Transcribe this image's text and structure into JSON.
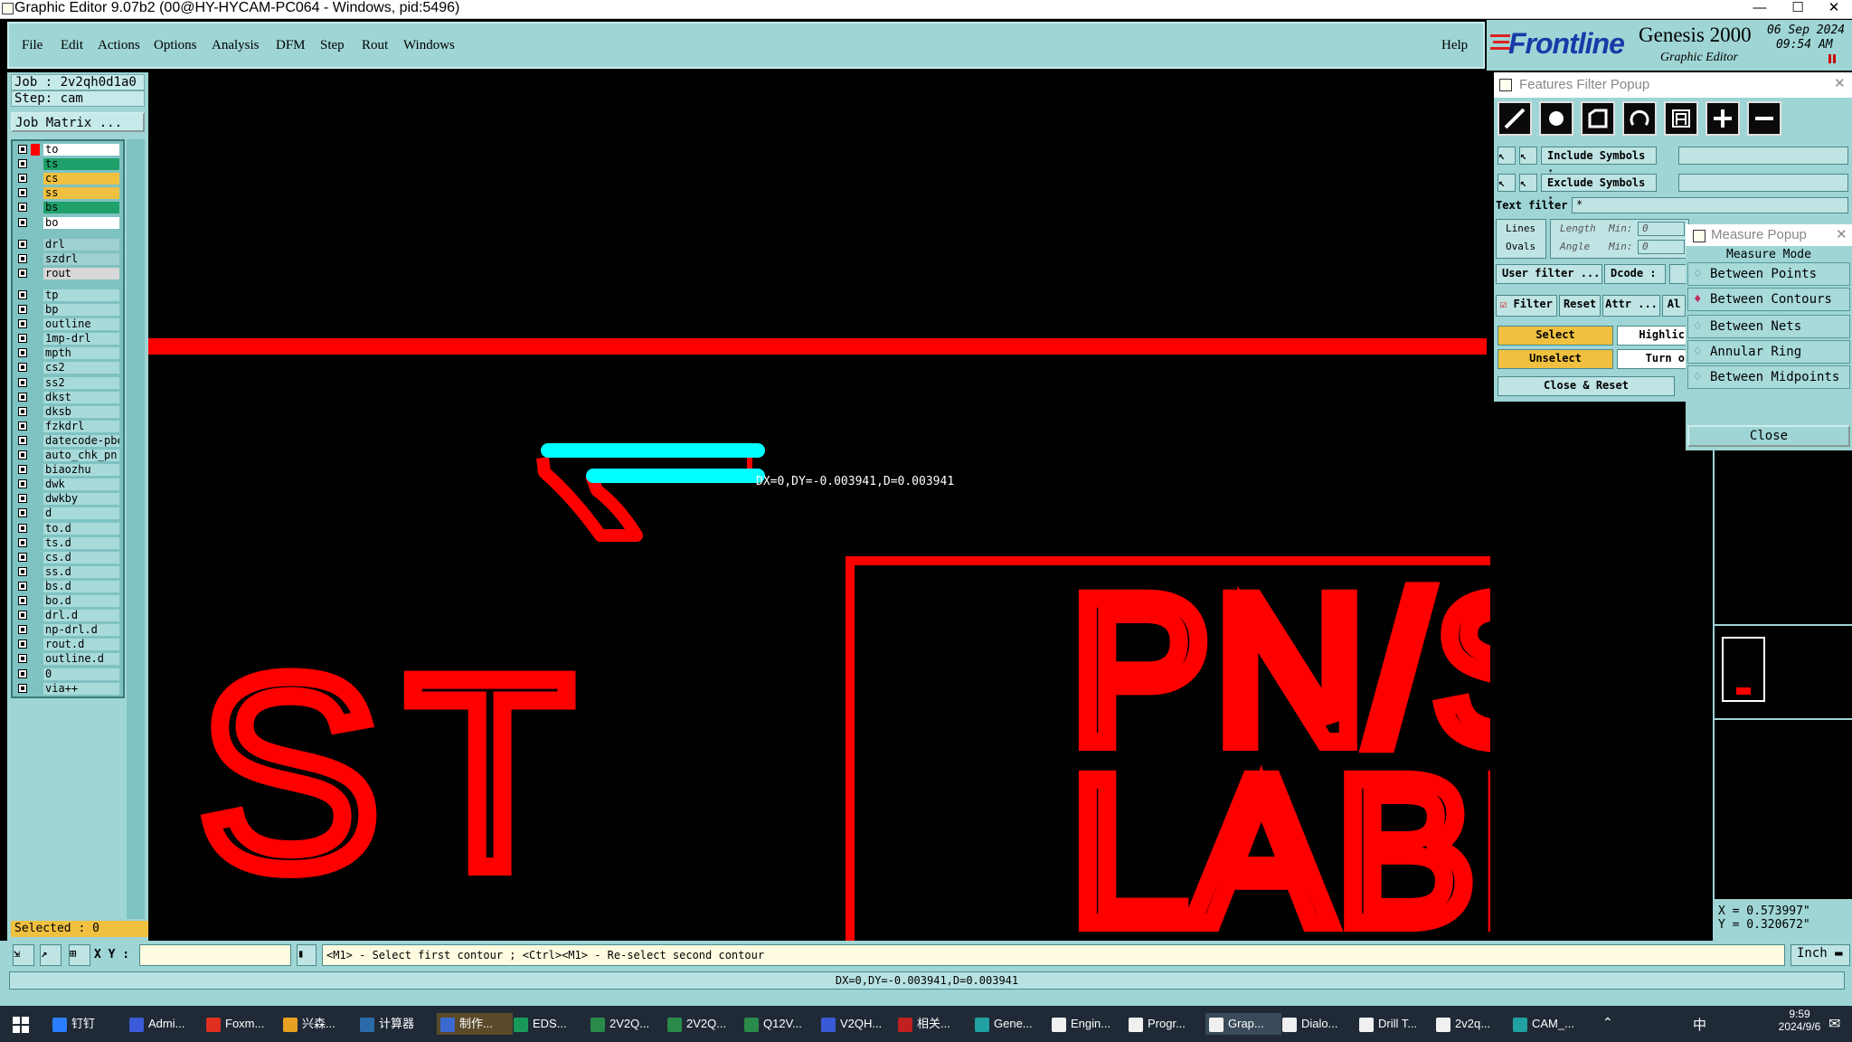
{
  "window": {
    "title": "Graphic Editor 9.07b2 (00@HY-HYCAM-PC064 - Windows, pid:5496)"
  },
  "menu": {
    "items": [
      "File",
      "Edit",
      "Actions",
      "Options",
      "Analysis",
      "DFM",
      "Step",
      "Rout",
      "Windows"
    ],
    "help": "Help"
  },
  "brand": {
    "logo": "Frontline",
    "product": "Genesis 2000",
    "subtitle": "Graphic Editor",
    "date": "06 Sep 2024",
    "time": "09:54 AM"
  },
  "job": {
    "job_line": "Job  : 2v2qh0d1a0",
    "step_line": "Step: cam",
    "matrix_button": "Job Matrix ..."
  },
  "layers": [
    {
      "name": "to",
      "color": "#ffffff"
    },
    {
      "name": "ts",
      "color": "#1fa06a"
    },
    {
      "name": "cs",
      "color": "#f0c040"
    },
    {
      "name": "ss",
      "color": "#f0c040"
    },
    {
      "name": "bs",
      "color": "#1fa06a"
    },
    {
      "name": "bo",
      "color": "#ffffff"
    },
    {
      "name": "drl",
      "color": "#9fcfcf"
    },
    {
      "name": "szdrl",
      "color": "#9fcfcf"
    },
    {
      "name": "rout",
      "color": "#d8d8d8"
    },
    {
      "name": "tp",
      "color": "#a8dada"
    },
    {
      "name": "bp",
      "color": "#a8dada"
    },
    {
      "name": "outline",
      "color": "#a8dada"
    },
    {
      "name": "1mp-drl",
      "color": "#a8dada"
    },
    {
      "name": "mpth",
      "color": "#a8dada"
    },
    {
      "name": "cs2",
      "color": "#a8dada"
    },
    {
      "name": "ss2",
      "color": "#a8dada"
    },
    {
      "name": "dkst",
      "color": "#a8dada"
    },
    {
      "name": "dksb",
      "color": "#a8dada"
    },
    {
      "name": "fzkdrl",
      "color": "#a8dada"
    },
    {
      "name": "datecode-pbe",
      "color": "#a8dada"
    },
    {
      "name": "auto_chk_pn",
      "color": "#a8dada"
    },
    {
      "name": "biaozhu",
      "color": "#a8dada"
    },
    {
      "name": "dwk",
      "color": "#a8dada"
    },
    {
      "name": "dwkby",
      "color": "#a8dada"
    },
    {
      "name": "d",
      "color": "#a8dada"
    },
    {
      "name": "to.d",
      "color": "#a8dada"
    },
    {
      "name": "ts.d",
      "color": "#a8dada"
    },
    {
      "name": "cs.d",
      "color": "#a8dada"
    },
    {
      "name": "ss.d",
      "color": "#a8dada"
    },
    {
      "name": "bs.d",
      "color": "#a8dada"
    },
    {
      "name": "bo.d",
      "color": "#a8dada"
    },
    {
      "name": "drl.d",
      "color": "#a8dada"
    },
    {
      "name": "np-drl.d",
      "color": "#a8dada"
    },
    {
      "name": "rout.d",
      "color": "#a8dada"
    },
    {
      "name": "outline.d",
      "color": "#a8dada"
    },
    {
      "name": "0",
      "color": "#a8dada"
    },
    {
      "name": "via++",
      "color": "#a8dada"
    }
  ],
  "selected": "Selected : 0",
  "canvas": {
    "measure_label": "DX=0,DY=-0.003941,D=0.003941",
    "text_st": "ST",
    "text_line1": "PN/SN",
    "text_line2": "LABEL"
  },
  "features_filter": {
    "title": "Features Filter Popup",
    "include_label": "Include Symbols :",
    "exclude_label": "Exclude Symbols :",
    "text_filter_label": "Text filter",
    "text_filter_value": "*",
    "lines": "Lines",
    "ovals": "Ovals",
    "length": "Length",
    "angle": "Angle",
    "min": "Min:",
    "min_value": "0",
    "user_filter": "User filter ...",
    "dcode": "Dcode :",
    "filter": "Filter",
    "reset": "Reset",
    "attr": "Attr ...",
    "al": "Al",
    "select": "Select",
    "unselect": "Unselect",
    "highlight": "Highlic",
    "turn": "Turn o",
    "close_reset": "Close & Reset"
  },
  "measure": {
    "title": "Measure Popup",
    "mode_label": "Measure Mode",
    "modes": [
      "Between Points",
      "Between Contours",
      "Between Nets",
      "Annular Ring",
      "Between Midpoints"
    ],
    "close": "Close"
  },
  "coords": {
    "x": "X = 0.573997\"",
    "y": "Y = 0.320672\""
  },
  "status": {
    "xy_label": "X Y :",
    "hint": "<M1> - Select first contour ; <Ctrl><M1> - Re-select second contour",
    "units": "Inch",
    "result": "DX=0,DY=-0.003941,D=0.003941"
  },
  "taskbar": {
    "items": [
      "钉钉",
      "Admi...",
      "Foxm...",
      "兴森...",
      "计算器",
      "制作...",
      "EDS...",
      "2V2Q...",
      "2V2Q...",
      "Q12V...",
      "V2QH...",
      "相关...",
      "Gene...",
      "Engin...",
      "Progr...",
      "Grap...",
      "Dialo...",
      "Drill T...",
      "2v2q...",
      "CAM_..."
    ],
    "ime": "中",
    "time": "9:59",
    "date": "2024/9/6"
  }
}
